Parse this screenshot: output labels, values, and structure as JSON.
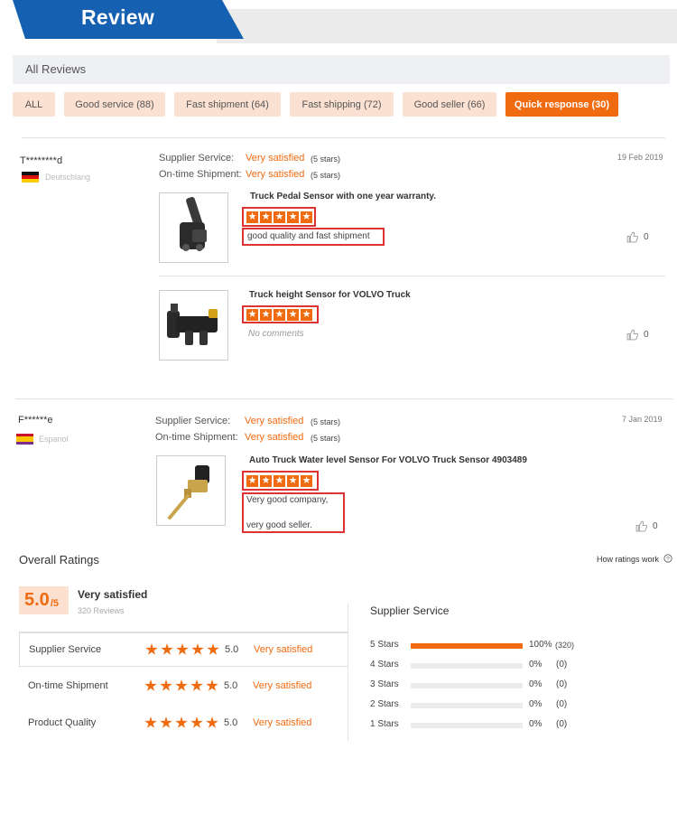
{
  "header": {
    "title": "Review"
  },
  "all_reviews": {
    "label": "All Reviews"
  },
  "filters": [
    {
      "label": "ALL",
      "active": false
    },
    {
      "label": "Good service (88)",
      "active": false
    },
    {
      "label": "Fast shipment (64)",
      "active": false
    },
    {
      "label": "Fast shipping (72)",
      "active": false
    },
    {
      "label": "Good seller (66)",
      "active": false
    },
    {
      "label": "Quick response (30)",
      "active": true
    }
  ],
  "reviews": [
    {
      "name": "T********d",
      "country": "Deutschlang",
      "supplier_label": "Supplier Service:",
      "supplier_value": "Very satisfied",
      "supplier_stars": "(5 stars)",
      "shipment_label": "On-time Shipment:",
      "shipment_value": "Very satisfied",
      "shipment_stars": "(5 stars)",
      "date": "19  Feb 2019",
      "products": [
        {
          "title": "Truck Pedal Sensor with one year warranty.",
          "rating": 5,
          "comment": "good quality and fast shipment",
          "likes": "0"
        },
        {
          "title": "Truck height Sensor for VOLVO Truck",
          "rating": 5,
          "comment": "No comments",
          "likes": "0"
        }
      ]
    },
    {
      "name": "F******e",
      "country": "Espanol",
      "supplier_label": "Supplier Service:",
      "supplier_value": "Very satisfied",
      "supplier_stars": "(5 stars)",
      "shipment_label": "On-time Shipment:",
      "shipment_value": "Very satisfied",
      "shipment_stars": "(5 stars)",
      "date": "7  Jan 2019",
      "products": [
        {
          "title": "Auto Truck Water level Sensor For VOLVO Truck Sensor 4903489",
          "rating": 5,
          "comment_lines": [
            "Very good company,",
            "very good seller."
          ],
          "likes": "0"
        }
      ]
    }
  ],
  "overall": {
    "title": "Overall Ratings",
    "how_link": "How ratings work",
    "score": "5.0",
    "score_max": "/5",
    "summary": "Very satisfied",
    "reviews_count": "320 Reviews",
    "rows": [
      {
        "label": "Supplier Service",
        "stars": 5,
        "score": "5.0",
        "text": "Very satisfied"
      },
      {
        "label": "On-time Shipment",
        "stars": 5,
        "score": "5.0",
        "text": "Very satisfied"
      },
      {
        "label": "Product Quality",
        "stars": 5,
        "score": "5.0",
        "text": "Very satisfied"
      }
    ]
  },
  "supplier_breakdown": {
    "title": "Supplier Service",
    "rows": [
      {
        "label": "5 Stars",
        "fraction": 1.0,
        "pct": "100%",
        "count": "(320)"
      },
      {
        "label": "4 Stars",
        "fraction": 0,
        "pct": "0%",
        "count": "(0)"
      },
      {
        "label": "3 Stars",
        "fraction": 0,
        "pct": "0%",
        "count": "(0)"
      },
      {
        "label": "2 Stars",
        "fraction": 0,
        "pct": "0%",
        "count": "(0)"
      },
      {
        "label": "1 Stars",
        "fraction": 0,
        "pct": "0%",
        "count": "(0)"
      }
    ]
  },
  "colors": {
    "accent": "#f06a10",
    "brand_blue": "#1560b0",
    "chip_bg": "#fbe1d2",
    "highlight_border": "#d33333"
  },
  "icons": [
    "thumbs-up-icon",
    "question-circle-icon",
    "flag-germany-icon",
    "flag-spain-icon",
    "star-icon"
  ]
}
